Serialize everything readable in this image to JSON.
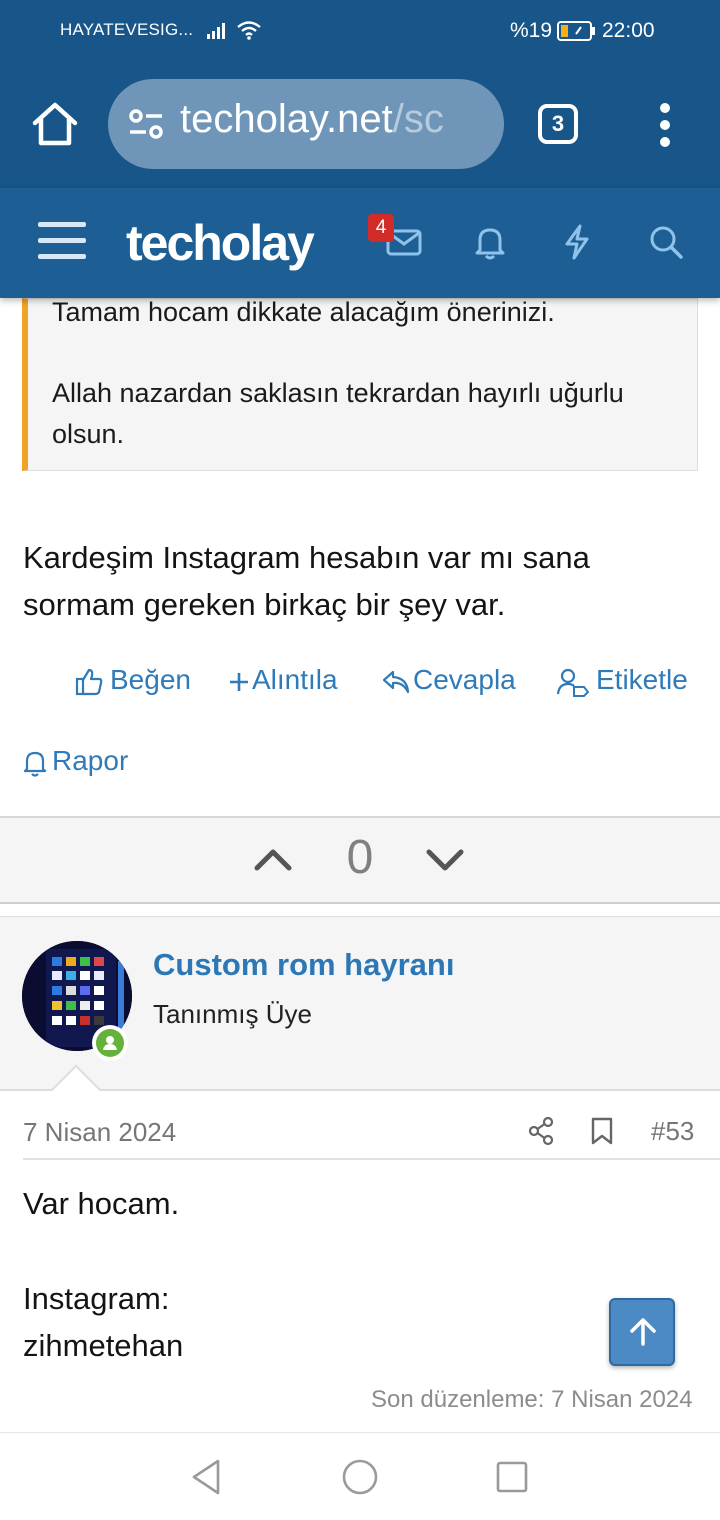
{
  "status_bar": {
    "carrier": "HAYATEVESIG...",
    "battery_percent": "%19",
    "time": "22:00"
  },
  "browser": {
    "url_host": "techolay.net",
    "url_path": "/sc",
    "tab_count": "3"
  },
  "site_header": {
    "logo": "techolay",
    "inbox_badge": "4"
  },
  "quote": {
    "line1": "Tamam hocam dikkate alacağım önerinizi.",
    "line2": "Allah nazardan saklasın tekrardan hayırlı uğurlu olsun."
  },
  "post": {
    "text_line1": "Kardeşim Instagram hesabın var mı sana",
    "text_line2": "sormam gereken birkaç bir şey var."
  },
  "actions": {
    "like": "Beğen",
    "quote": "Alıntıla",
    "reply": "Cevapla",
    "tag": "Etiketle",
    "report": "Rapor"
  },
  "votes": {
    "count": "0"
  },
  "next_post": {
    "username": "Custom rom hayranı",
    "user_title": "Tanınmış Üye",
    "date": "7 Nisan 2024",
    "post_number": "#53",
    "body_line1": "Var hocam.",
    "body_line2": "Instagram:",
    "body_line3": "zihmetehan",
    "last_edited": "Son düzenleme: 7 Nisan 2024"
  },
  "colors": {
    "header_blue": "#1d5f94",
    "status_blue": "#185588",
    "link_blue": "#2f7ab8",
    "quote_accent": "#f0a325",
    "badge_red": "#d32a2a",
    "online_green": "#65b23a"
  },
  "icons": {
    "home": "home-icon",
    "tune": "site-settings-icon",
    "menu": "more-vert-icon",
    "hamburger": "hamburger-icon",
    "inbox": "envelope-icon",
    "alerts": "bell-icon",
    "whats_new": "bolt-icon",
    "search": "search-icon",
    "like": "thumbs-up-icon",
    "share": "share-icon",
    "bookmark": "bookmark-icon"
  }
}
